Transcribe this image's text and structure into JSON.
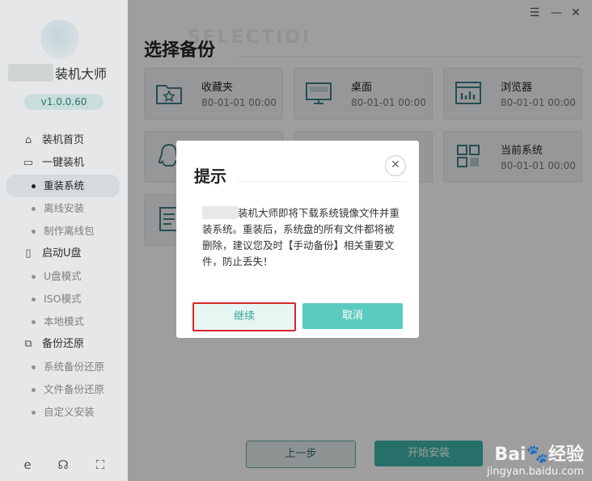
{
  "sidebar": {
    "brand_suffix": "装机大师",
    "version": "v1.0.0.60",
    "nav": [
      {
        "type": "item",
        "icon": "⌂",
        "icon_name": "home-icon",
        "label": "装机首页"
      },
      {
        "type": "item",
        "icon": "▭",
        "icon_name": "monitor-icon",
        "label": "一键装机"
      },
      {
        "type": "sub",
        "label": "重装系统",
        "active": true
      },
      {
        "type": "sub",
        "label": "离线安装"
      },
      {
        "type": "sub",
        "label": "制作离线包"
      },
      {
        "type": "item",
        "icon": "▯",
        "icon_name": "usb-icon",
        "label": "启动U盘"
      },
      {
        "type": "sub",
        "label": "U盘模式"
      },
      {
        "type": "sub",
        "label": "ISO模式"
      },
      {
        "type": "sub",
        "label": "本地模式"
      },
      {
        "type": "item",
        "icon": "⧉",
        "icon_name": "backup-icon",
        "label": "备份还原"
      },
      {
        "type": "sub",
        "label": "系统备份还原"
      },
      {
        "type": "sub",
        "label": "文件备份还原"
      },
      {
        "type": "sub",
        "label": "自定义安装"
      }
    ],
    "bottom_icons": [
      "ie-browser-icon",
      "chat-icon",
      "scan-icon"
    ]
  },
  "window": {
    "minimize_glyph": "—",
    "menu_glyph": "☰",
    "close_glyph": "✕"
  },
  "main": {
    "watermark": "SELECTIOI",
    "title": "选择备份",
    "cards": [
      {
        "name": "收藏夹",
        "date": "80-01-01 00:00",
        "icon": "folder-star-icon"
      },
      {
        "name": "桌面",
        "date": "80-01-01 00:00",
        "icon": "desktop-icon"
      },
      {
        "name": "浏览器",
        "date": "80-01-01 00:00",
        "icon": "browser-icon"
      },
      {
        "name": "",
        "date": "",
        "icon": "qq-icon"
      },
      {
        "name": "",
        "date": "",
        "icon": "blank-card"
      },
      {
        "name": "当前系统",
        "date": "80-01-01 00:00",
        "icon": "windows-grid-icon"
      },
      {
        "name": "",
        "date": "",
        "icon": "document-icon"
      }
    ],
    "prev_button": "上一步",
    "start_button": "开始安装"
  },
  "dialog": {
    "title": "提示",
    "close_glyph": "✕",
    "message_part1": "装机大师即将下载系统镜像文件并重装系统。重装后，系统盘的所有文件都将被删除，建议您及时【手动备份】相关重要文件，防止丢失！",
    "continue_label": "继续",
    "cancel_label": "取消"
  },
  "watermark": {
    "brand": "Bai",
    "brand2": "经验",
    "url": "jingyan.baidu.com"
  }
}
